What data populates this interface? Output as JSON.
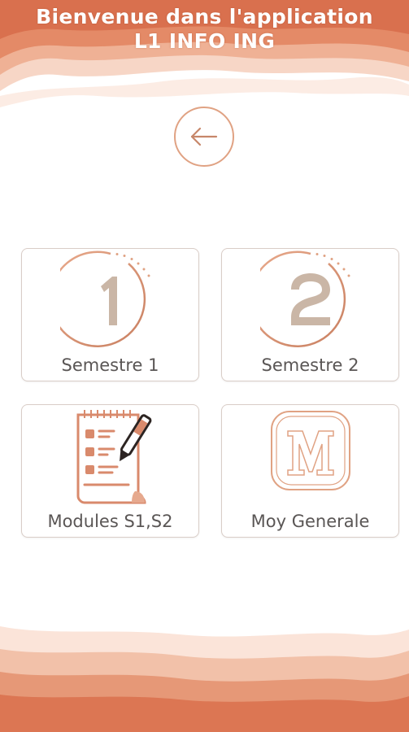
{
  "header": {
    "title_line1": "Bienvenue dans l'application",
    "title_line2": "L1 INFO ING"
  },
  "back_button": {
    "icon": "arrow-left-icon"
  },
  "menu": {
    "items": [
      {
        "label": "Semestre 1",
        "icon": "semester-1-icon"
      },
      {
        "label": "Semestre 2",
        "icon": "semester-2-icon"
      },
      {
        "label": "Modules S1,S2",
        "icon": "notepad-pen-icon"
      },
      {
        "label": "Moy Generale",
        "icon": "letter-m-icon"
      }
    ]
  },
  "colors": {
    "accent": "#e0a283",
    "accent_dark": "#d9704e",
    "wave_light": "#f3c5ad",
    "text": "#5a5655"
  }
}
